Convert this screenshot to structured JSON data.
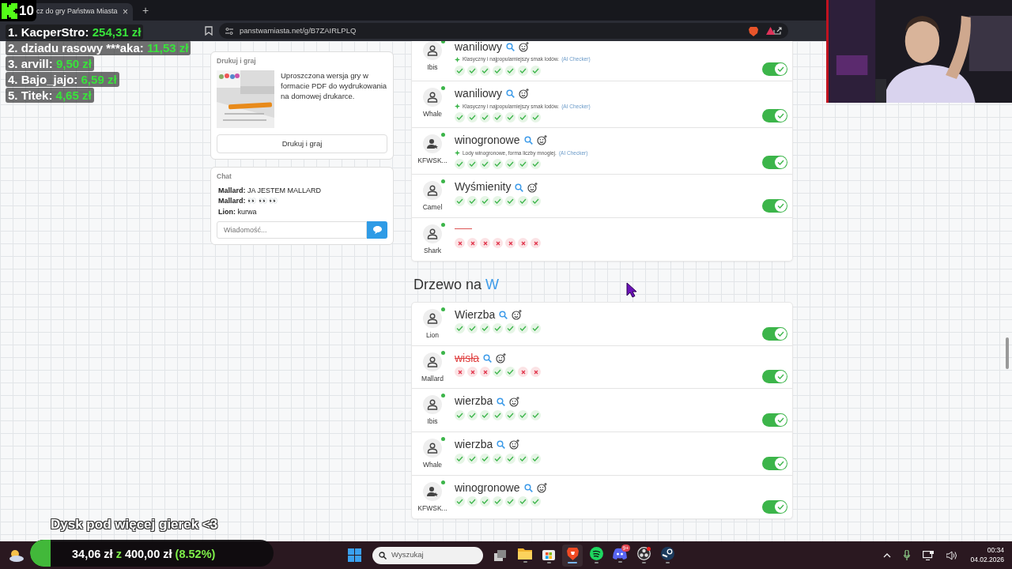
{
  "browser": {
    "tab": {
      "title": "cz do gry Państwa Miasta",
      "close": "×"
    },
    "new_tab": "+",
    "url": "panstwamiasta.net/g/B7ZAIRLPLQ"
  },
  "stream_overlay": {
    "badge": "10",
    "leaderboard": [
      {
        "name": "1. KacperStro:",
        "amount": "254,31 zł"
      },
      {
        "name": "2. dziadu rasowy ***aka:",
        "amount": "11,53 zł"
      },
      {
        "name": "3. arvill:",
        "amount": "9,50 zł"
      },
      {
        "name": "4. Bajo_jajo:",
        "amount": "6,59 zł"
      },
      {
        "name": "5. Titek:",
        "amount": "4,65 zł"
      }
    ],
    "banner": "Dysk pod więcej gierek <3",
    "goal": {
      "raised": "34,06 zł",
      "separator": "z",
      "target": "400,00 zł",
      "percent": "(8.52%)",
      "level": 0.0852
    }
  },
  "print_card": {
    "title": "Drukuj i graj",
    "description": "Uproszczona wersja gry w formacie PDF do wydrukowania na domowej drukarce.",
    "button": "Drukuj i graj"
  },
  "chat": {
    "title": "Chat",
    "messages": [
      {
        "author": "Mallard:",
        "text": "JA JESTEM MALLARD"
      },
      {
        "author": "Mallard:",
        "text": "👀 👀 👀"
      },
      {
        "author": "Lion:",
        "text": "kurwa"
      }
    ],
    "placeholder": "Wiadomość..."
  },
  "sections": [
    {
      "rows": [
        {
          "player": "Ibis",
          "kind": "user",
          "online": true,
          "answer": "waniliowy",
          "struck": false,
          "note": "Klasyczny i najpopularniejszy smak lodów.",
          "note_source": "(AI Checker)",
          "votes": [
            true,
            true,
            true,
            true,
            true,
            true,
            true
          ],
          "accepted": true
        },
        {
          "player": "Whale",
          "kind": "user",
          "online": true,
          "answer": "waniliowy",
          "struck": false,
          "note": "Klasyczny i najpopularniejszy smak lodów.",
          "note_source": "(AI Checker)",
          "votes": [
            true,
            true,
            true,
            true,
            true,
            true,
            true
          ],
          "accepted": true
        },
        {
          "player": "KFWSK...",
          "kind": "vip",
          "online": true,
          "answer": "winogronowe",
          "struck": false,
          "note": "Lody winogronowe, forma liczby mnogiej.",
          "note_source": "(AI Checker)",
          "votes": [
            true,
            true,
            true,
            true,
            true,
            true,
            true
          ],
          "accepted": true
        },
        {
          "player": "Camel",
          "kind": "user",
          "online": true,
          "answer": "Wyśmienity",
          "struck": false,
          "votes": [
            true,
            true,
            true,
            true,
            true,
            true,
            true
          ],
          "accepted": true
        },
        {
          "player": "Shark",
          "kind": "user",
          "online": true,
          "votes": [
            false,
            false,
            false,
            false,
            false,
            false,
            false
          ]
        }
      ]
    },
    {
      "title": "Drzewo na",
      "letter": "W",
      "rows": [
        {
          "player": "Lion",
          "kind": "user",
          "online": true,
          "answer": "Wierzba",
          "struck": false,
          "votes": [
            true,
            true,
            true,
            true,
            true,
            true,
            true
          ],
          "accepted": true
        },
        {
          "player": "Mallard",
          "kind": "user",
          "online": true,
          "answer": "wisła",
          "struck": true,
          "votes": [
            false,
            false,
            false,
            true,
            true,
            false,
            false
          ],
          "accepted": true
        },
        {
          "player": "Ibis",
          "kind": "user",
          "online": true,
          "answer": "wierzba",
          "struck": false,
          "votes": [
            true,
            true,
            true,
            true,
            true,
            true,
            true
          ],
          "accepted": true
        },
        {
          "player": "Whale",
          "kind": "user",
          "online": true,
          "answer": "wierzba",
          "struck": false,
          "votes": [
            true,
            true,
            true,
            true,
            true,
            true,
            true
          ],
          "accepted": true
        },
        {
          "player": "KFWSK...",
          "kind": "vip",
          "online": true,
          "answer": "winogronowe",
          "struck": false,
          "votes": [
            true,
            true,
            true,
            true,
            true,
            true,
            true
          ],
          "accepted": true
        }
      ]
    }
  ],
  "taskbar": {
    "search_placeholder": "Wyszukaj",
    "apps": [
      {
        "kind": "explorer",
        "selected": false
      },
      {
        "kind": "store",
        "selected": false
      },
      {
        "kind": "brave",
        "selected": true
      },
      {
        "kind": "spotify",
        "selected": false
      },
      {
        "kind": "discord",
        "selected": false,
        "badge": "9+"
      },
      {
        "kind": "obs",
        "selected": false
      },
      {
        "kind": "steam",
        "selected": false
      }
    ],
    "time": "00:34",
    "date": "04.02.2026"
  }
}
